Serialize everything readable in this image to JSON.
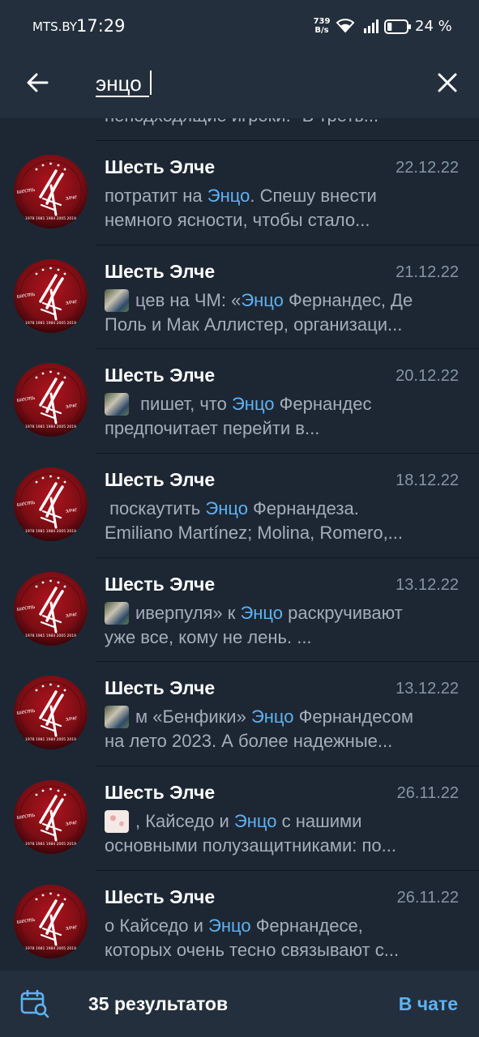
{
  "status_bar": {
    "carrier": "MTS.BY",
    "time": "17:29",
    "net_speed_value": "739",
    "net_speed_unit": "B/s",
    "battery_percent": "24 %",
    "battery_level": 0.24
  },
  "search": {
    "query": "энцо",
    "back_icon": "arrow-left-icon",
    "clear_icon": "close-icon"
  },
  "partial_item": {
    "snippet": "неподходящие игроки. \"В треть..."
  },
  "results": [
    {
      "chat": "Шесть Элче",
      "date": "22.12.22",
      "thumb": null,
      "line1": [
        "потратит на ",
        "Энцо",
        ". Спешу внести"
      ],
      "line2": "немного ясности, чтобы стало..."
    },
    {
      "chat": "Шесть Элче",
      "date": "21.12.22",
      "thumb": "photo",
      "line1": [
        "цев на ЧМ: «",
        "Энцо",
        " Фернандес, Де"
      ],
      "line2": "Поль и Мак Аллистер, организаци..."
    },
    {
      "chat": "Шесть Элче",
      "date": "20.12.22",
      "thumb": "photo",
      "line1": [
        " пишет, что ",
        "Энцо",
        " Фернандес"
      ],
      "line2": "предпочитает перейти в..."
    },
    {
      "chat": "Шесть Элче",
      "date": "18.12.22",
      "thumb": null,
      "line1": [
        " поскаутить ",
        "Энцо",
        " Фернандеза."
      ],
      "line2": "Emiliano Martínez; Molina, Romero,..."
    },
    {
      "chat": "Шесть Элче",
      "date": "13.12.22",
      "thumb": "photo",
      "line1": [
        "иверпуля» к ",
        "Энцо",
        " раскручивают"
      ],
      "line2": "уже все, кому не лень.  ..."
    },
    {
      "chat": "Шесть Элче",
      "date": "13.12.22",
      "thumb": "photo",
      "line1": [
        "м «Бенфики» ",
        "Энцо",
        " Фернандесом"
      ],
      "line2": "на лето 2023. А более надежные..."
    },
    {
      "chat": "Шесть Элче",
      "date": "26.11.22",
      "thumb": "light",
      "line1": [
        ", Кайседо и ",
        "Энцо",
        " с нашими"
      ],
      "line2": "основными полузащитниками: по..."
    },
    {
      "chat": "Шесть Элче",
      "date": "26.11.22",
      "thumb": null,
      "line1": [
        "о Кайседо и ",
        "Энцо",
        " Фернандесе,"
      ],
      "line2": "которых очень тесно связывают с..."
    }
  ],
  "bottom_bar": {
    "results_count": "35 результатов",
    "in_chat": "В чате",
    "calendar_icon": "calendar-search-icon"
  },
  "colors": {
    "background": "#1d2733",
    "bar": "#232f3c",
    "accent": "#5fb2f2",
    "secondary_text": "#a3aeba"
  },
  "avatar_logo": {
    "text_left": "шесть",
    "text_right": "элче",
    "years": "1978 1981 1984 2005 2019"
  }
}
